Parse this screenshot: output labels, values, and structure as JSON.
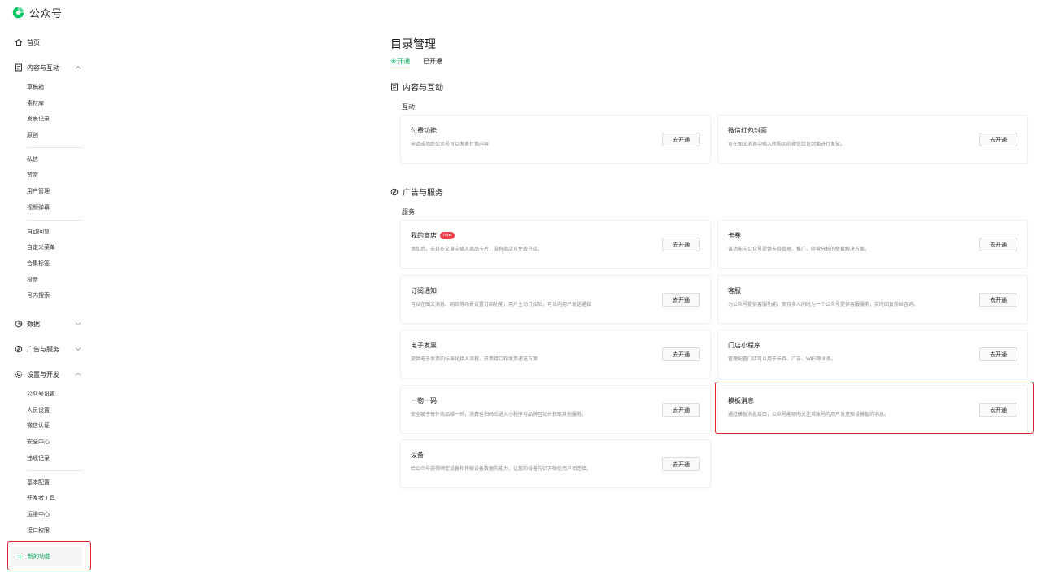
{
  "header": {
    "brand": "公众号"
  },
  "sidebar": {
    "home": "首页",
    "content_interaction": {
      "label": "内容与互动",
      "items": [
        "草稿箱",
        "素材库",
        "发表记录",
        "原创",
        "私信",
        "赞赏",
        "用户管理",
        "视频弹幕",
        "自动回复",
        "自定义菜单",
        "合集标签",
        "投票",
        "号内搜索"
      ]
    },
    "data": {
      "label": "数据"
    },
    "ads_services": {
      "label": "广告与服务"
    },
    "settings_dev": {
      "label": "设置与开发",
      "items": [
        "公众号设置",
        "人员设置",
        "微信认证",
        "安全中心",
        "违规记录",
        "基本配置",
        "开发者工具",
        "运维中心",
        "接口权限"
      ]
    },
    "new_feature": "新的功能"
  },
  "main": {
    "title": "目录管理",
    "tabs": [
      {
        "label": "未开通",
        "active": true
      },
      {
        "label": "已开通",
        "active": false
      }
    ],
    "sections": [
      {
        "title": "内容与互动",
        "group": "互动",
        "cards": [
          {
            "title": "付费功能",
            "desc": "申请成功后公众号可以发表付费内容",
            "button": "去开通"
          },
          {
            "title": "微信红包封面",
            "desc": "可在图文消息中插入所购买的微信红包封面进行发放。",
            "button": "去开通"
          }
        ]
      },
      {
        "title": "广告与服务",
        "group": "服务",
        "cards": [
          {
            "title": "我的商店",
            "badge": "new",
            "desc": "添加后，支持在文章中插入商品卡片，没有商店可免费开店。",
            "button": "去开通"
          },
          {
            "title": "卡券",
            "desc": "该功能向公众号提供卡券管理、推广、经营分析的整套解决方案。",
            "button": "去开通"
          },
          {
            "title": "订阅通知",
            "desc": "可以在图文消息、网页等场景设置订阅功能，用户主动订阅后，可以向用户发送通知",
            "button": "去开通"
          },
          {
            "title": "客服",
            "desc": "为公众号提供客服功能，支持多人同时为一个公众号提供客服服务，实时回复粉丝咨询。",
            "button": "去开通"
          },
          {
            "title": "电子发票",
            "desc": "提供电子发票的标准化接入流程、开票接口和发票递送方案",
            "button": "去开通"
          },
          {
            "title": "门店小程序",
            "desc": "管理配置门店可以用于卡券、广告、WIFI等业务。",
            "button": "去开通"
          },
          {
            "title": "一物一码",
            "desc": "安全赋予每件商品唯一码，消费者扫码后进入小程序与品牌互动并获取其他服务。",
            "button": "去开通"
          },
          {
            "title": "模板消息",
            "desc": "通过模板消息接口，公众号能够向关注其账号的用户发送预设模板的消息。",
            "button": "去开通"
          },
          {
            "title": "设备",
            "desc": "给公众号获得绑定设备和传输设备数据的能力，让您的设备与亿万微信用户相连接。",
            "button": "去开通"
          }
        ]
      }
    ]
  },
  "colors": {
    "accent": "#07a658",
    "highlight": "#e6232c",
    "badge": "#f0444a"
  }
}
